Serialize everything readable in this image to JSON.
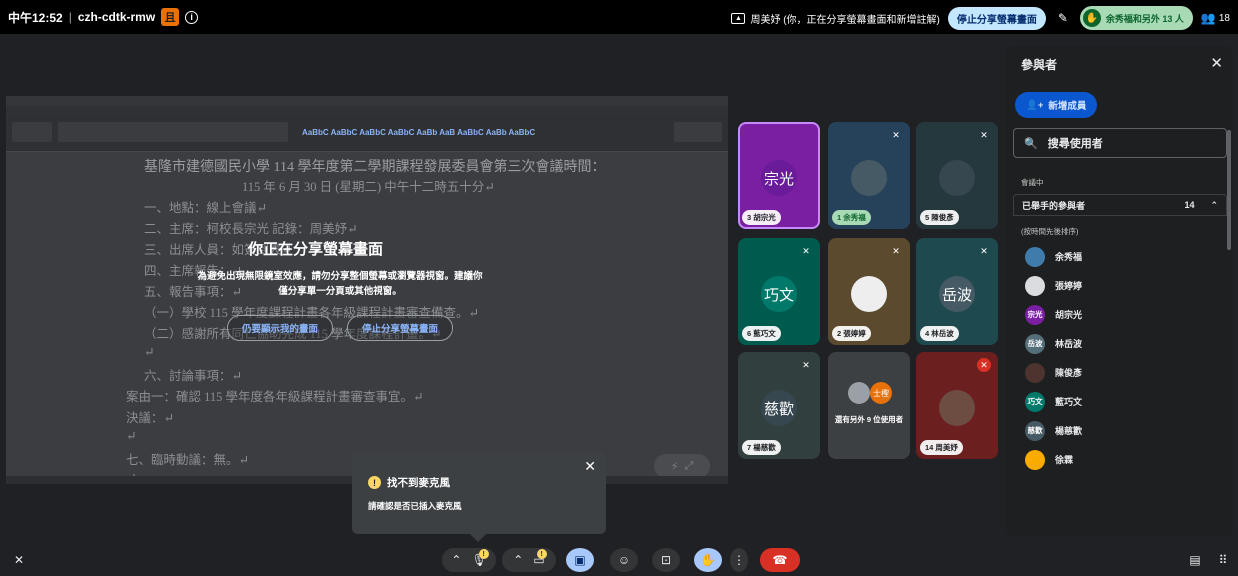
{
  "topbar": {
    "time": "中午12:52",
    "meeting_code": "czh-cdtk-rmw",
    "badge": "且",
    "info_icon": "i",
    "presenting_text": "周美妤 (你，正在分享螢幕畫面和新增註解)",
    "stop_share_label": "停止分享螢幕畫面",
    "raised_text": "余秀福和另外 13 人",
    "participant_count": "18"
  },
  "screen": {
    "doc_lines": [
      "基隆市建德國民小學 114 學年度第二學期課程發展委員會第三次會議時間：",
      "115 年 6 月 30 日 (星期二) 中午十二時五十分↵",
      "一、地點：線上會議↵",
      "二、主席：柯校長宗光                    記錄：周美妤↵",
      "三、出席人員：如簽到表↵",
      "四、主席報告：↵",
      "五、報告事項：↵",
      "（一）學校 115 學年度課程計畫各年級課程計畫審查備查。↵",
      "（二）感謝所有同仁協助完成 115 學年度課程計畫。↵",
      "↵",
      "六、討論事項：↵",
      "案由一：確認 115 學年度各年級課程計畫審查事宜。↵",
      "決議：↵",
      "↵",
      "七、臨時動議：無。↵",
      "↵"
    ],
    "overlay_title": "你正在分享螢幕畫面",
    "overlay_desc": "為避免出現無限鏡室效應，請勿分享整個螢幕或瀏覽器視窗。建議你僅分享單一分頁或其他視窗。",
    "show_anyway_label": "仍要顯示我的畫面",
    "stop_share_label": "停止分享螢幕畫面"
  },
  "tiles": [
    {
      "avatar": "宗光",
      "name": "3 胡宗光",
      "color": "#6a1b9a",
      "bg": "#7b1fa2",
      "highlight": true
    },
    {
      "avatar": "",
      "name": "1 余秀福",
      "color": "#455a64",
      "bg": "#26425a",
      "green": true,
      "muted": true
    },
    {
      "avatar": "",
      "name": "5 陳俊彥",
      "color": "#37474f",
      "bg": "#25383d",
      "muted": true
    },
    {
      "avatar": "巧文",
      "name": "6 藍巧文",
      "color": "#00796b",
      "bg": "#005b4f",
      "muted": true
    },
    {
      "avatar": "",
      "name": "2 張婷婷",
      "color": "#eeeeee",
      "bg": "#5c4a2e",
      "muted": true
    },
    {
      "avatar": "岳波",
      "name": "4 林岳波",
      "color": "#455a64",
      "bg": "#1e4a4f",
      "muted": true
    },
    {
      "avatar": "慈歡",
      "name": "7 楊慈歡",
      "color": "#37474f",
      "bg": "#31403e",
      "muted": true
    },
    {
      "more": "還有另外 9 位使用者",
      "avatar": "士檉"
    },
    {
      "avatar": "",
      "name": "14 周美妤",
      "color": "#6d4c41",
      "bg": "#6b1f1f",
      "muted": true,
      "red_mute": true
    }
  ],
  "panel": {
    "title": "參與者",
    "add_label": "新增成員",
    "search_placeholder": "搜尋使用者",
    "section": "會議中",
    "group_title": "已舉手的參與者",
    "group_count": "14",
    "sub_label": "(按時間先後排序)",
    "people": [
      {
        "name": "余秀福",
        "av": "",
        "color": "#3f7cac"
      },
      {
        "name": "張婷婷",
        "av": "",
        "color": "#dadce0"
      },
      {
        "name": "胡宗光",
        "av": "宗光",
        "color": "#7b1fa2"
      },
      {
        "name": "林岳波",
        "av": "岳波",
        "color": "#546e7a"
      },
      {
        "name": "陳俊彥",
        "av": "",
        "color": "#4e342e"
      },
      {
        "name": "藍巧文",
        "av": "巧文",
        "color": "#00796b"
      },
      {
        "name": "楊慈歡",
        "av": "慈歡",
        "color": "#455a64"
      },
      {
        "name": "徐霖",
        "av": "",
        "color": "#f9ab00"
      }
    ]
  },
  "toast": {
    "title": "找不到麥克風",
    "body": "請確認是否已插入麥克風"
  },
  "colors": {
    "accent_blue": "#a8c7fa",
    "end_call_red": "#d93025",
    "warning_yellow": "#fdd663"
  }
}
